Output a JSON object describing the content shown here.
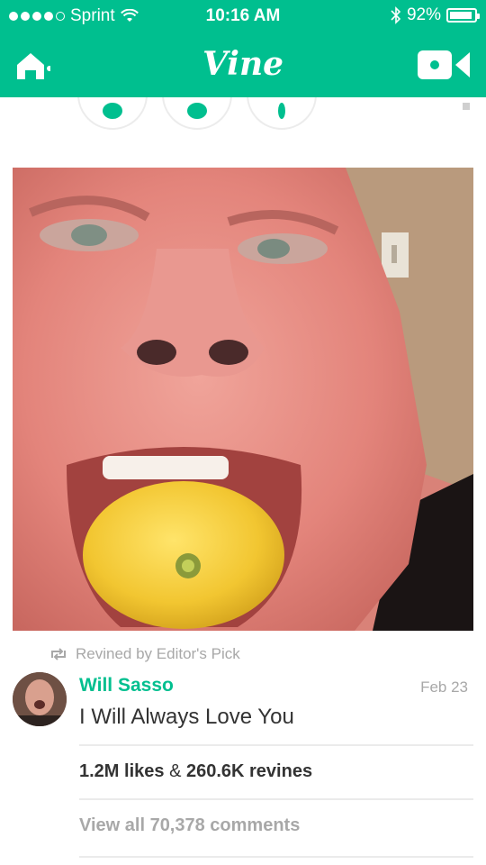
{
  "status_bar": {
    "carrier": "Sprint",
    "time": "10:16 AM",
    "battery": "92%",
    "battery_level": 0.92
  },
  "nav": {
    "brand": "Vine",
    "home_icon": "home-icon",
    "camera_icon": "video-camera-icon"
  },
  "post": {
    "revined_label": "Revined by Editor's Pick",
    "author": "Will Sasso",
    "date": "Feb 23",
    "caption": "I Will Always Love You",
    "likes": "1.2M likes",
    "likes_sep": " & ",
    "revines": "260.6K revines",
    "comments_link": "View all 70,378 comments"
  },
  "colors": {
    "accent": "#00bf8f",
    "muted_text": "#a8a8a8",
    "body_text": "#333333"
  }
}
